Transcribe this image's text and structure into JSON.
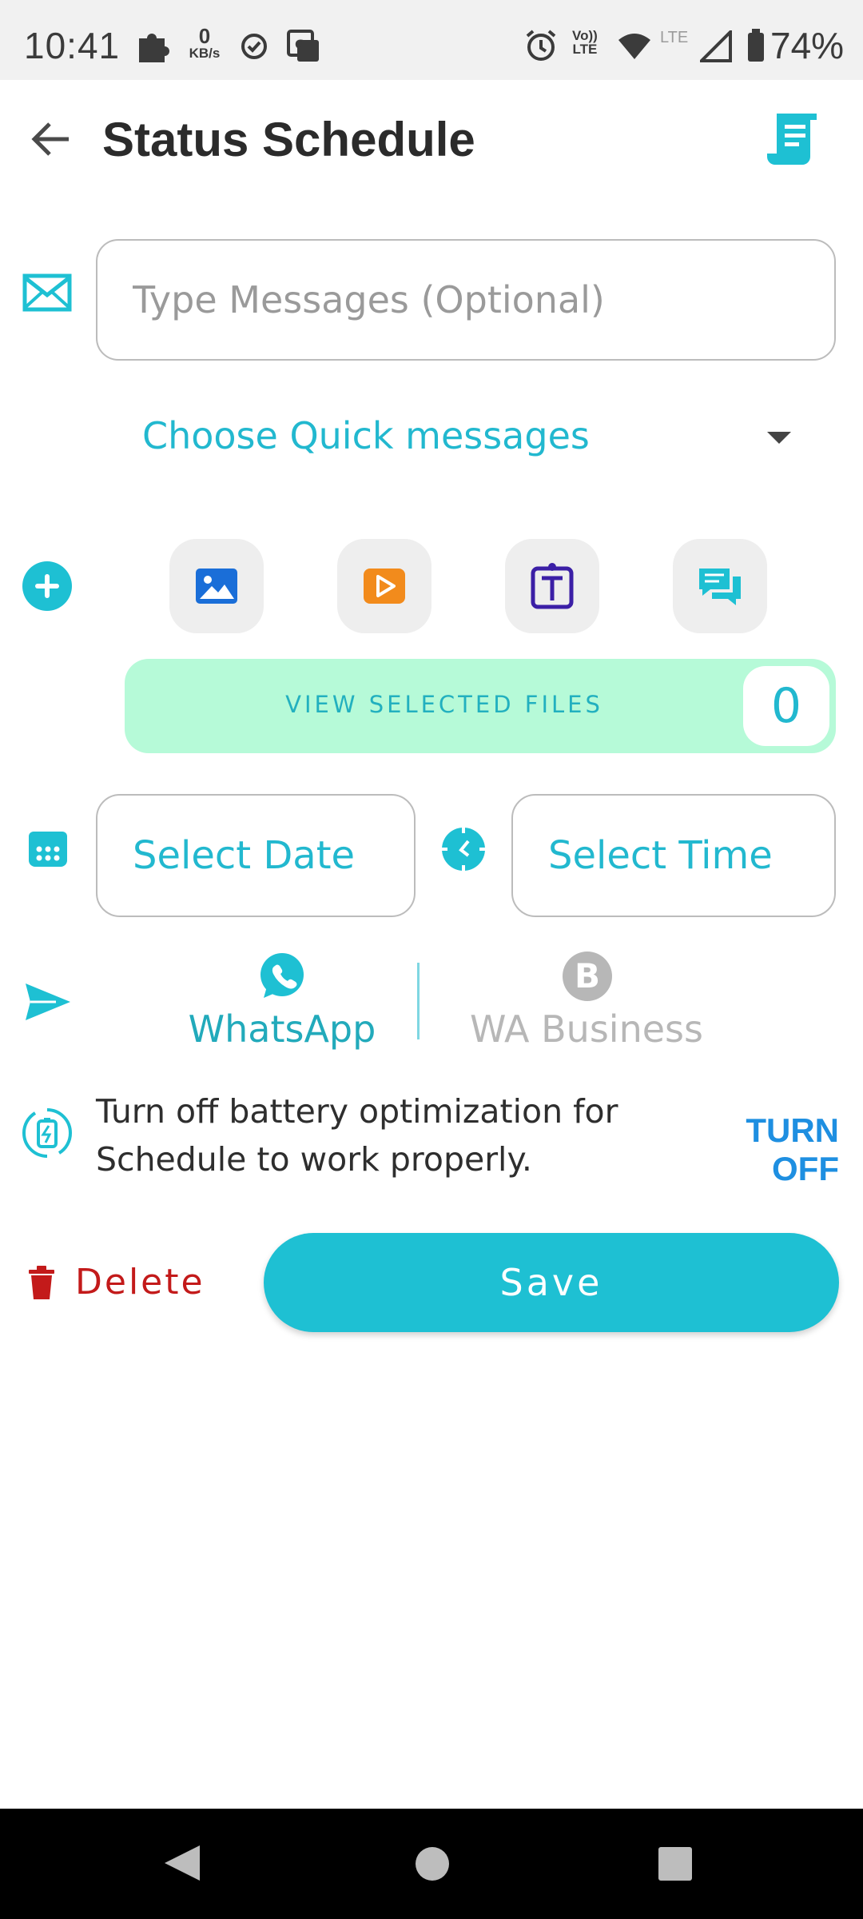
{
  "status_bar": {
    "time": "10:41",
    "net_speed_value": "0",
    "net_speed_unit": "KB/s",
    "volte_line1": "Vo))",
    "volte_line2": "LTE",
    "lte_label": "LTE",
    "battery_percent": "74%",
    "icons": [
      "puzzle-icon",
      "check-circle-icon",
      "translate-icon",
      "alarm-icon",
      "wifi-icon",
      "signal-icon",
      "battery-icon"
    ]
  },
  "app_bar": {
    "title": "Status Schedule",
    "back_icon": "arrow-left-icon",
    "action_icon": "receipt-icon"
  },
  "message": {
    "placeholder": "Type Messages (Optional)",
    "value": "",
    "quick_messages_label": "Choose Quick messages"
  },
  "media": {
    "add_icon": "plus-circle-icon",
    "buttons": [
      "image-icon",
      "video-play-icon",
      "text-icon",
      "chat-bubbles-icon"
    ],
    "view_selected_label": "VIEW SELECTED FILES",
    "selected_count": "0"
  },
  "schedule": {
    "date_label": "Select Date",
    "time_label": "Select Time"
  },
  "targets": {
    "whatsapp_label": "WhatsApp",
    "wa_business_label": "WA Business",
    "wa_business_letter": "B"
  },
  "battery_notice": {
    "text": "Turn off battery optimization for Schedule to work properly.",
    "action_label": "TURN OFF"
  },
  "actions": {
    "delete_label": "Delete",
    "save_label": "Save"
  },
  "colors": {
    "accent": "#1ec0d3",
    "files_bar": "#b6fad8",
    "delete": "#c31a1a",
    "link": "#1e8fe1",
    "disabled": "#b7b7b7"
  }
}
